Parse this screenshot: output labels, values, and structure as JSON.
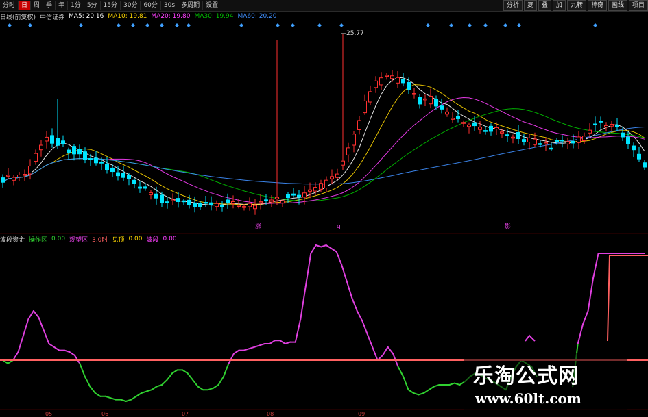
{
  "toolbar": {
    "left_items": [
      "分时",
      "日",
      "周",
      "季",
      "年",
      "1分",
      "5分",
      "15分",
      "30分",
      "60分",
      "30s",
      "多周期",
      "设置"
    ],
    "right_items": [
      "分析",
      "复",
      "叠",
      "加",
      "九转",
      "神奇",
      "画线",
      "项目"
    ]
  },
  "info": {
    "title": "日线(前复权)",
    "name": "中信证券",
    "ma5": "MA5: 20.16",
    "ma10": "MA10: 19.81",
    "ma20": "MA20: 19.80",
    "ma30": "MA30: 19.94",
    "ma60": "MA60: 20.20"
  },
  "info2": {
    "label1": "波段资金",
    "label2": "操作区",
    "val2": "0.00",
    "label3": "观望区",
    "label4": "3.0时",
    "label5": "见顶",
    "val5": "0.00",
    "label6": "波段",
    "val6": "0.00"
  },
  "markers": {
    "peak_label": "25.77",
    "marker_a": "涨",
    "marker_b": "q",
    "marker_c": "影"
  },
  "watermark": {
    "cn": "乐淘公式网",
    "url": "www.60lt.com"
  },
  "axis_ticks": [
    "05",
    "06",
    "07",
    "08",
    "09"
  ],
  "colors": {
    "up": "#ff3030",
    "down": "#00e5ff",
    "ma5": "#ffffff",
    "ma10": "#ffd700",
    "ma20": "#ff40ff",
    "ma30": "#00c000",
    "ma60": "#4090ff",
    "osc_high": "#e040e0",
    "osc_low": "#30d030",
    "threshold": "#ff6060",
    "diamond": "#3fa0ff"
  },
  "chart_data": [
    {
      "type": "candlestick",
      "title": "中信证券",
      "series": [
        {
          "name": "MA5",
          "values": [
            20.16
          ]
        },
        {
          "name": "MA10",
          "values": [
            19.81
          ]
        },
        {
          "name": "MA20",
          "values": [
            19.8
          ]
        },
        {
          "name": "MA30",
          "values": [
            19.94
          ]
        },
        {
          "name": "MA60",
          "values": [
            20.2
          ]
        }
      ],
      "peak_annotation": 25.77
    },
    {
      "type": "line",
      "series": [
        {
          "name": "osc",
          "values": [
            30,
            28,
            30,
            35,
            45,
            55,
            60,
            56,
            48,
            40,
            38,
            36,
            36,
            35,
            33,
            28,
            20,
            14,
            10,
            8,
            8,
            7,
            6,
            6,
            5,
            6,
            8,
            10,
            11,
            12,
            14,
            15,
            18,
            22,
            24,
            24,
            22,
            18,
            14,
            12,
            12,
            13,
            15,
            20,
            28,
            34,
            36,
            36,
            37,
            38,
            39,
            40,
            40,
            42,
            42,
            40,
            41,
            41,
            55,
            75,
            95,
            100,
            99,
            100,
            98,
            96,
            88,
            78,
            68,
            60,
            54,
            46,
            38,
            30,
            33,
            38,
            34,
            26,
            20,
            12,
            10,
            9,
            10,
            12,
            14,
            15,
            15,
            15,
            16,
            15,
            17,
            20,
            22,
            21,
            19,
            18,
            16,
            14,
            12,
            20,
            26,
            30,
            28,
            26,
            20,
            16,
            18,
            22,
            20,
            18,
            16,
            14,
            40,
            52,
            60,
            80,
            95,
            95,
            95,
            95,
            95,
            95,
            95,
            95,
            95,
            95
          ]
        }
      ],
      "threshold": 30
    }
  ]
}
